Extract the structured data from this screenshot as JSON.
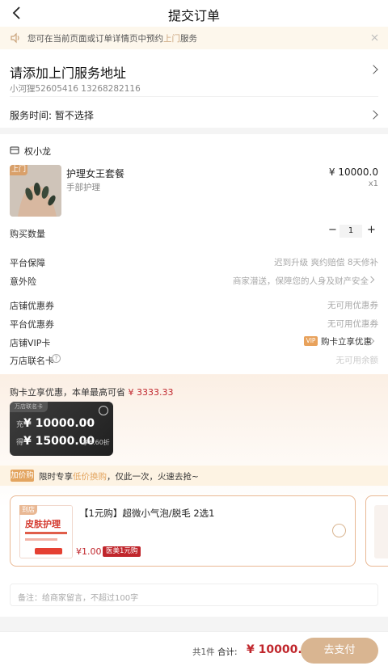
{
  "header": {
    "title": "提交订单"
  },
  "notice": {
    "text_pre": "您可在当前页面或订单详情页中预约",
    "text_highlight": "上门",
    "text_post": "服务"
  },
  "address": {
    "title": "请添加上门服务地址",
    "contact": "小河狸52605416  13268282116"
  },
  "service_time": {
    "label": "服务时间:",
    "value": "暂不选择"
  },
  "shop": {
    "name": "权小龙"
  },
  "product": {
    "badge": "上门",
    "name": "护理女王套餐",
    "category": "手部护理",
    "price": "¥ 10000.0",
    "count": "x1"
  },
  "quantity": {
    "label": "购买数量",
    "minus": "−",
    "value": "1",
    "plus": "+"
  },
  "rows": {
    "guarantee_label": "平台保障",
    "guarantee_value": "迟到升级  爽约赔偿  8天修补",
    "insurance_label": "意外险",
    "insurance_value": "商家潜送，保障您的人身及财产安全",
    "shop_coupon_label": "店铺优惠券",
    "shop_coupon_value": "无可用优惠券",
    "platform_coupon_label": "平台优惠券",
    "platform_coupon_value": "无可用优惠券",
    "vip_label": "店铺VIP卡",
    "vip_tag": "VIP",
    "vip_value": "购卡立享优惠",
    "union_label": "万店联名卡",
    "union_value": "无可用余额"
  },
  "promo": {
    "title_pre": "购卡立享优惠，本单最高可省",
    "title_amount": "¥ 3333.33",
    "card_name": "万店联名卡",
    "charge_label": "充",
    "charge_amount": "¥ 10000.00",
    "get_label": "得",
    "get_amount": "¥ 15000.00",
    "discount": "享6.60折"
  },
  "addon": {
    "tag": "加价购",
    "text_pre": "限时专享",
    "text_highlight": "低价换购",
    "text_post": "，仅此一次，火速去抢~",
    "product_badge": "到店",
    "product_thumb_title": "皮肤护理",
    "product_name": "【1元购】超微小气泡/脱毛 2选1",
    "product_price": "¥1.00",
    "product_tag": "医美1元购"
  },
  "remark": {
    "placeholder": "备注：给商家留言，不超过100字"
  },
  "bottom": {
    "count": "共1件",
    "total_label": "合计:",
    "total": "¥ 10000.00",
    "pay": "去支付"
  },
  "colors": {
    "accent": "#d9b591",
    "price_red": "#c0262c",
    "highlight": "#c9a27a"
  }
}
